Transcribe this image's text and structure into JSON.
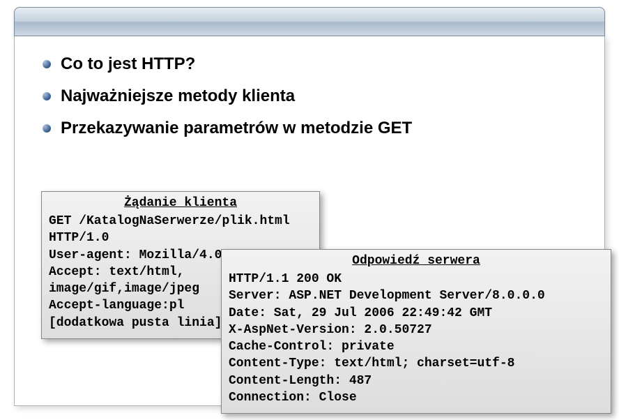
{
  "bullets": [
    "Co to jest HTTP?",
    "Najważniejsze metody klienta",
    "Przekazywanie parametrów w metodzie GET"
  ],
  "request": {
    "title": "Żądanie klienta",
    "body": "GET /KatalogNaSerwerze/plik.html HTTP/1.0\nUser-agent: Mozilla/4.0\nAccept: text/html, image/gif,image/jpeg\nAccept-language:pl\n[dodatkowa pusta linia]"
  },
  "response": {
    "title": "Odpowiedź serwera",
    "body": "HTTP/1.1 200 OK\nServer: ASP.NET Development Server/8.0.0.0\nDate: Sat, 29 Jul 2006 22:49:42 GMT\nX-AspNet-Version: 2.0.50727\nCache-Control: private\nContent-Type: text/html; charset=utf-8\nContent-Length: 487\nConnection: Close"
  }
}
